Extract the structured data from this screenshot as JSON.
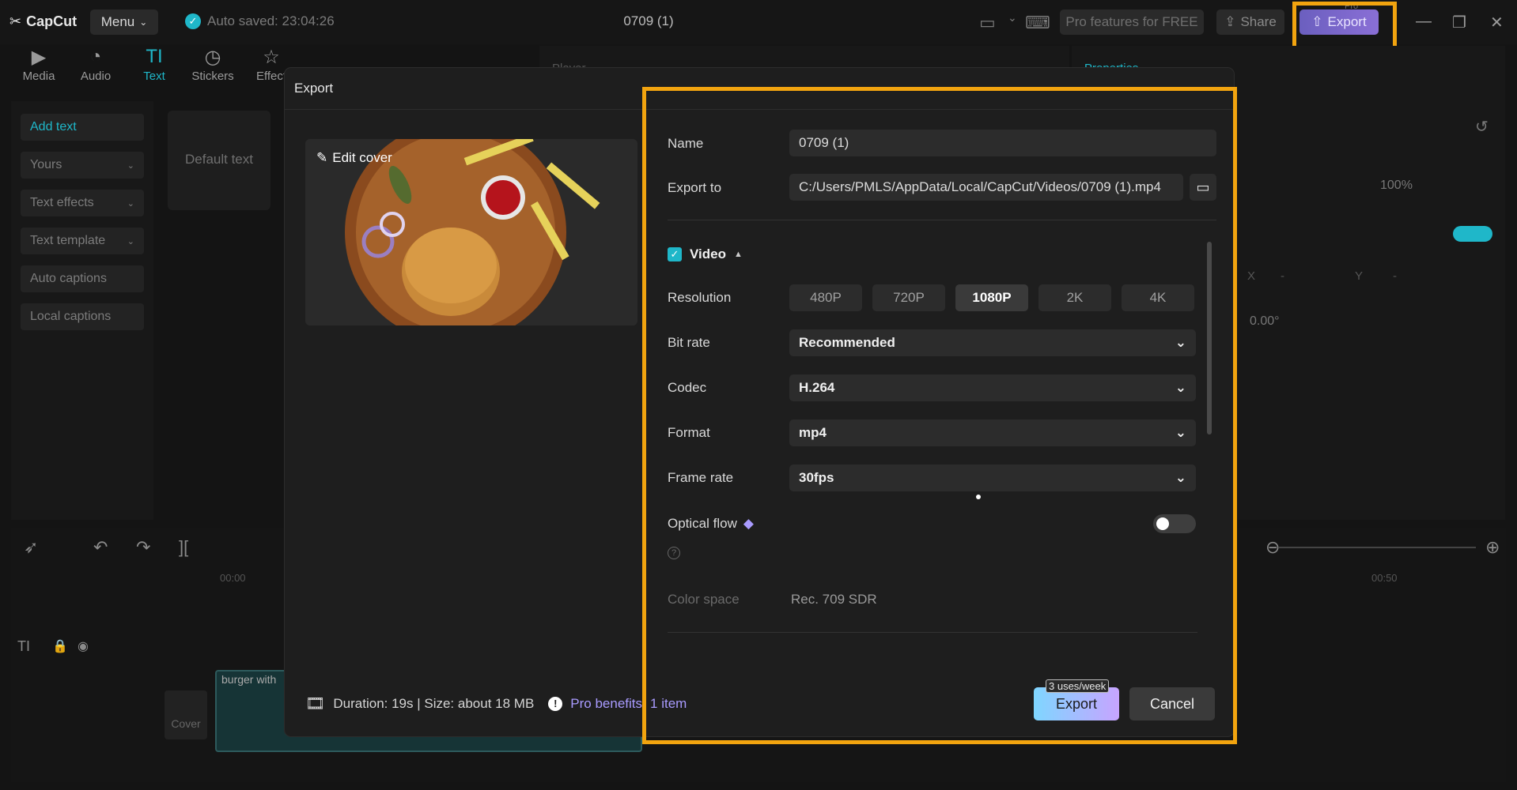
{
  "app": {
    "logo": "CapCut",
    "menu_label": "Menu",
    "autosave": "Auto saved: 23:04:26",
    "title": "0709 (1)",
    "pro_free": "Pro features for FREE",
    "share": "Share",
    "export": "Export",
    "pro_tag": "Pro"
  },
  "tools": [
    "Media",
    "Audio",
    "Text",
    "Stickers",
    "Effect"
  ],
  "left_panel": {
    "items": [
      "Add text",
      "Yours",
      "Text effects",
      "Text template",
      "Auto captions",
      "Local captions"
    ],
    "default_text": "Default text"
  },
  "background": {
    "player": "Player",
    "properties": "Properties",
    "percent": "100%",
    "x_label": "X",
    "y_label": "Y",
    "dash": "-",
    "rotation": "0.00°",
    "time_start": "00:00",
    "time_end": "00:50",
    "clip_label": "burger with",
    "cover_label": "Cover"
  },
  "dialog": {
    "title": "Export",
    "edit_cover": "Edit cover",
    "footer": "Duration: 19s | Size: about 18 MB",
    "pro_benefits": "Pro benefits",
    "pro_items": "1 item",
    "name_label": "Name",
    "name_value": "0709 (1)",
    "export_to_label": "Export to",
    "export_to_value": "C:/Users/PMLS/AppData/Local/CapCut/Videos/0709 (1).mp4",
    "video_label": "Video",
    "resolution_label": "Resolution",
    "resolutions": [
      "480P",
      "720P",
      "1080P",
      "2K",
      "4K"
    ],
    "selected_resolution": "1080P",
    "bitrate_label": "Bit rate",
    "bitrate_value": "Recommended",
    "codec_label": "Codec",
    "codec_value": "H.264",
    "format_label": "Format",
    "format_value": "mp4",
    "framerate_label": "Frame rate",
    "framerate_value": "30fps",
    "optical_flow_label": "Optical flow",
    "color_space_label": "Color space",
    "color_space_value": "Rec. 709 SDR",
    "uses_badge": "3 uses/week",
    "export_button": "Export",
    "cancel_button": "Cancel"
  },
  "colors": {
    "accent": "#1fb7c9",
    "highlight": "#f2a40f",
    "pro": "#a99bff"
  }
}
